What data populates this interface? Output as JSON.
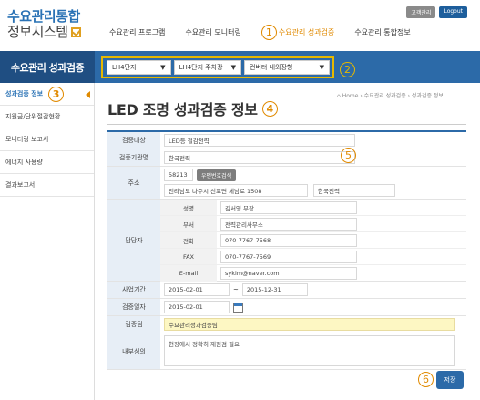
{
  "app": {
    "title_line1": "수요관리통합",
    "title_line2": "정보시스템"
  },
  "gnb": {
    "items": [
      {
        "label": "수요관리 프로그램"
      },
      {
        "label": "수요관리 모니터링"
      },
      {
        "label": "수요관리 성과검증",
        "marker": "1"
      },
      {
        "label": "수요관리 통합정보"
      }
    ]
  },
  "top_buttons": {
    "admin": "고객관리",
    "logout": "Logout"
  },
  "sidebar": {
    "title": "수요관리 성과검증",
    "items": [
      {
        "label": "성과검증 정보",
        "marker": "3"
      },
      {
        "label": "지원금/단위절감현황"
      },
      {
        "label": "모니터링 보고서"
      },
      {
        "label": "에너지 사용량"
      },
      {
        "label": "결과보고서"
      }
    ]
  },
  "filters": {
    "marker": "2",
    "select1": "LH4단지",
    "select2": "LH4단지 주차장",
    "select3": "컨버터 내외장형"
  },
  "breadcrumb": "⌂ Home › 수요관리 성과검증 › 성과검증 정보",
  "page": {
    "title": "LED 조명 성과검증 정보",
    "marker": "4"
  },
  "form": {
    "marker": "5",
    "target_label": "검증대상",
    "target_value": "LED등 절감전력",
    "org_label": "검증기관명",
    "org_value": "한국전력",
    "addr_label": "주소",
    "zip": "58213",
    "zip_button": "우편번호검색",
    "addr1": "전라남도 나주시 신포면 세남로 1508",
    "addr2": "한국전력",
    "contact_label": "담당자",
    "contact": [
      {
        "label": "성명",
        "value": "김서영 부장"
      },
      {
        "label": "부서",
        "value": "전력관리사무소"
      },
      {
        "label": "전화",
        "value": "070-7767-7568"
      },
      {
        "label": "FAX",
        "value": "070-7767-7569"
      },
      {
        "label": "E-mail",
        "value": "sykim@naver.com"
      }
    ],
    "period_label": "사업기간",
    "period_start": "2015-02-01",
    "period_sep": "~",
    "period_end": "2015-12-31",
    "date_label": "검증일자",
    "date_value": "2015-02-01",
    "team_label": "검증팀",
    "team_value": "수요관리성과검증팀",
    "opinion_label": "내부심의",
    "opinion_value": "현장에서 정확히 재점검 필요"
  },
  "save": {
    "label": "저장",
    "marker": "6"
  },
  "colors": {
    "primary": "#2c6aa8",
    "dark": "#1f4e82",
    "accent": "#e08a00",
    "highlight": "#e6b800"
  }
}
